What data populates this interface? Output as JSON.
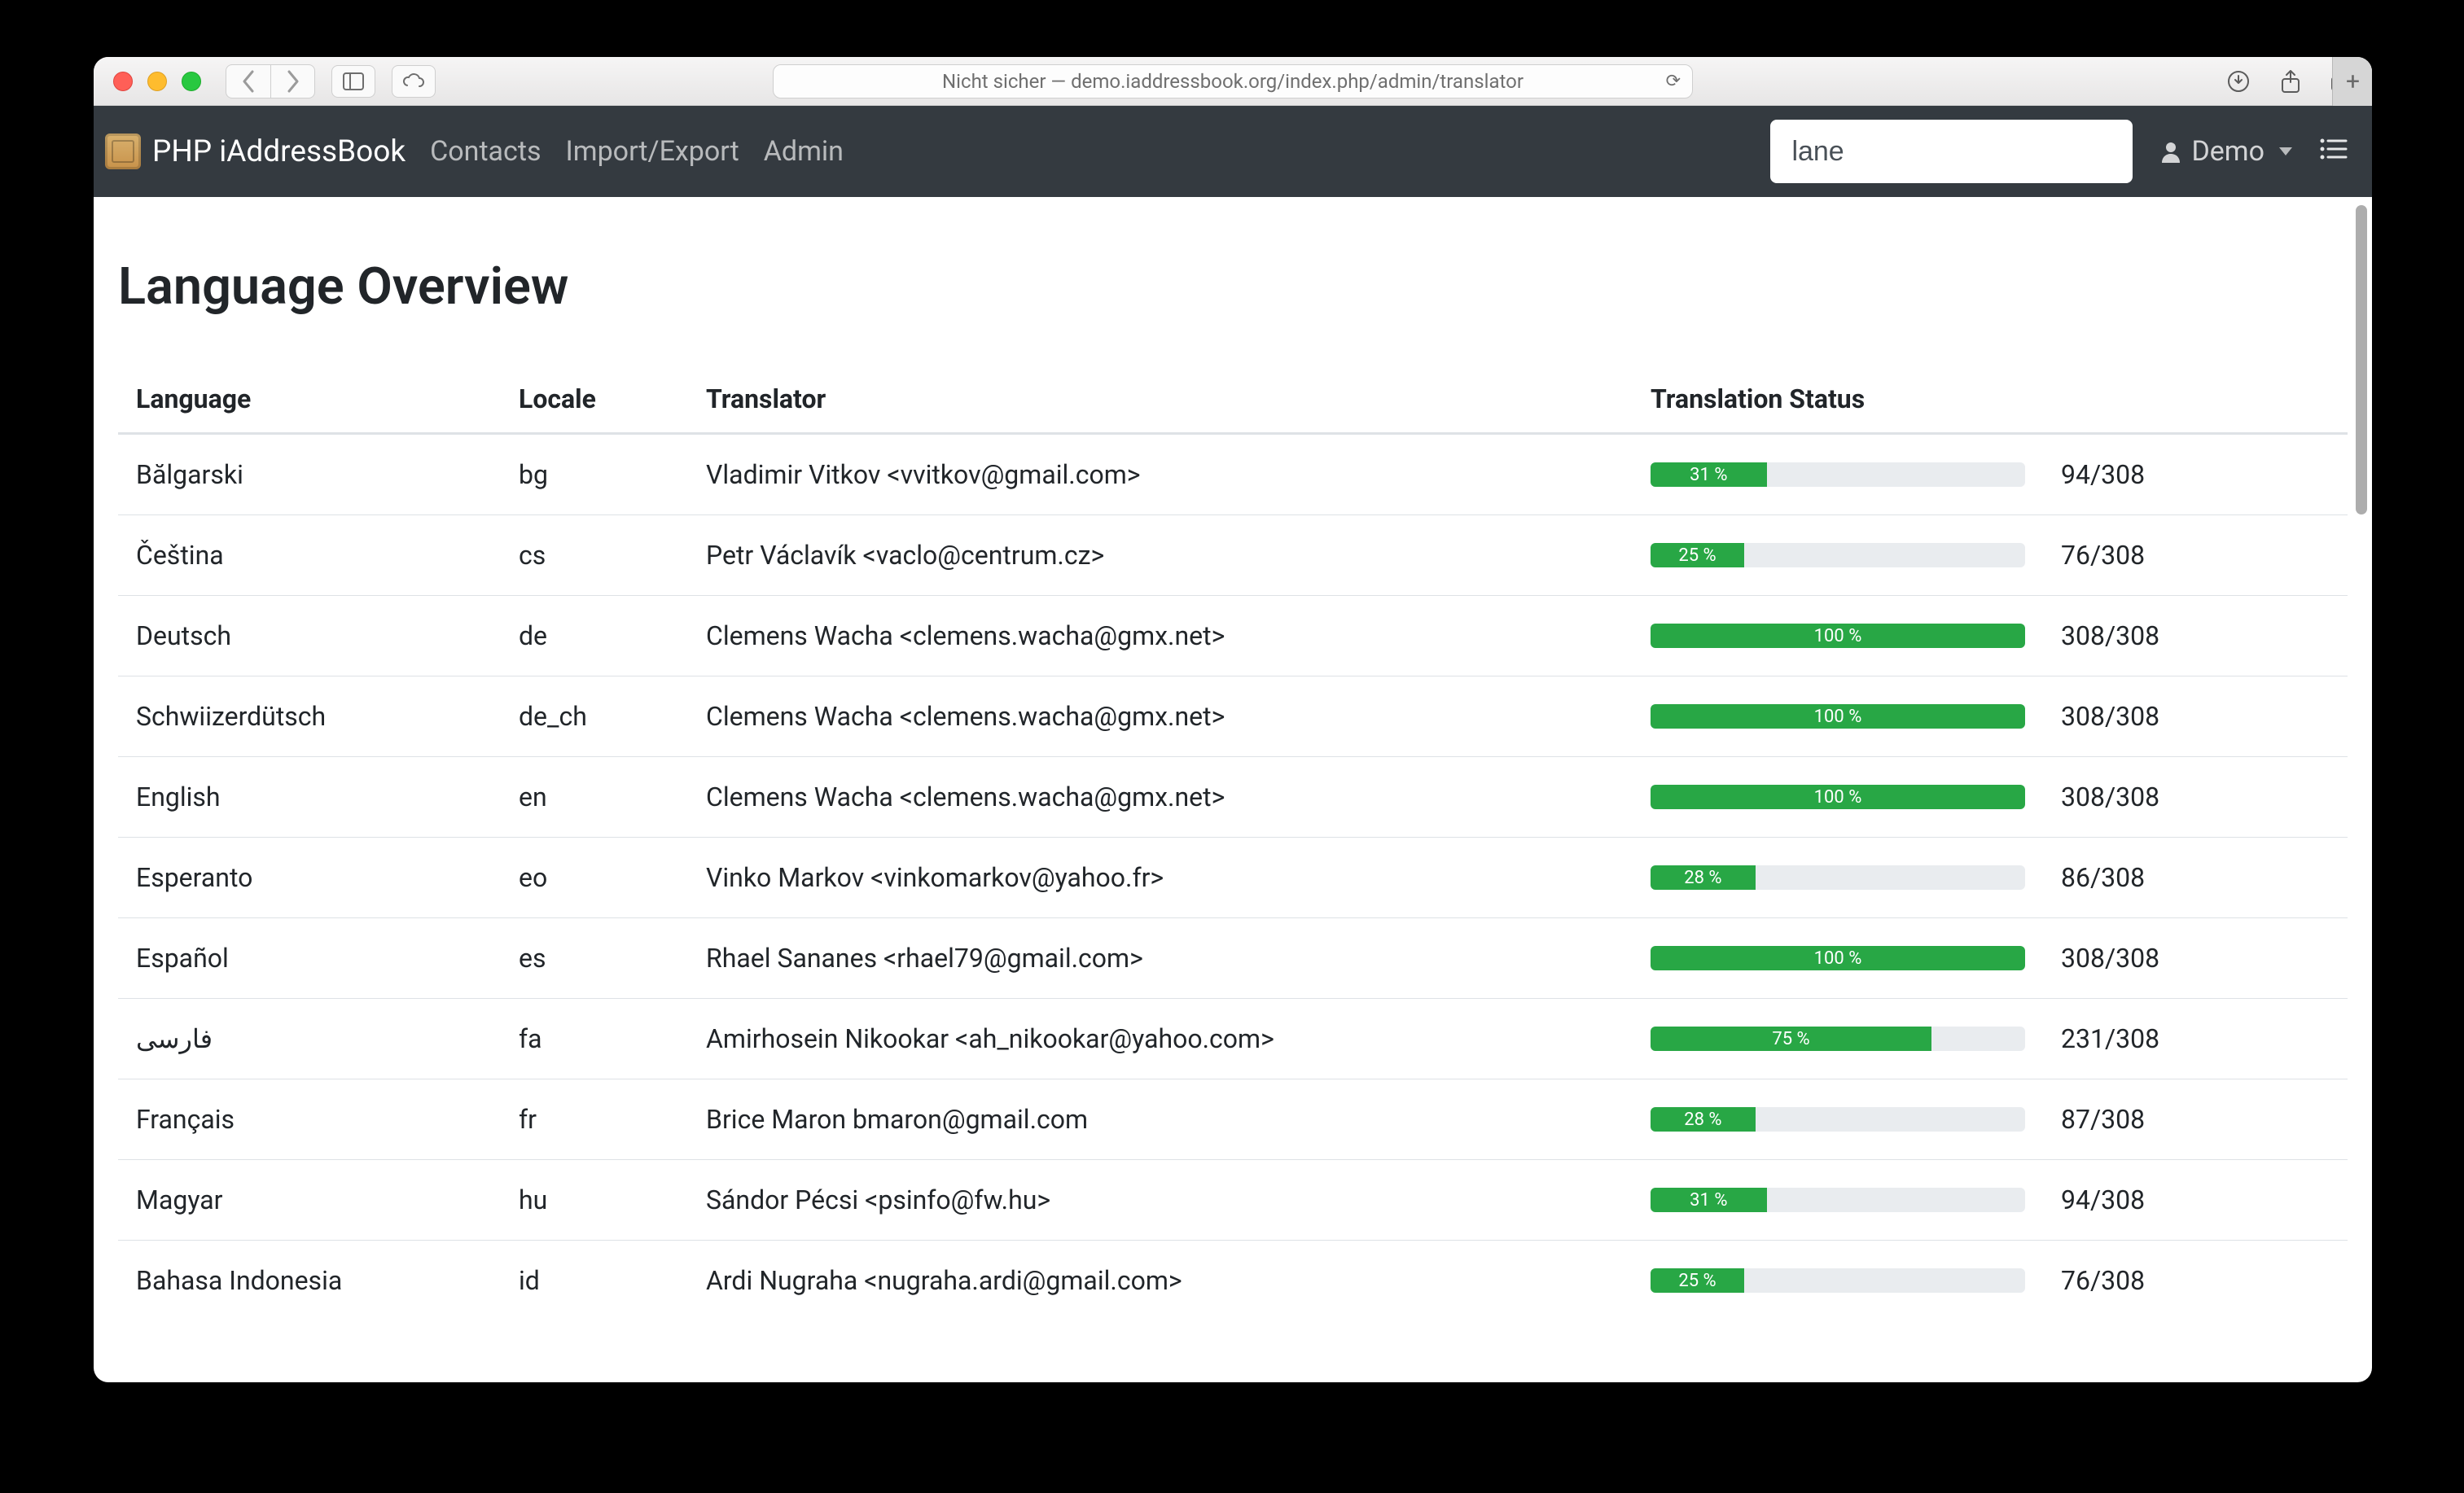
{
  "browser": {
    "address_prefix": "Nicht sicher — ",
    "url": "demo.iaddressbook.org/index.php/admin/translator"
  },
  "navbar": {
    "brand": "PHP iAddressBook",
    "links": [
      "Contacts",
      "Import/Export",
      "Admin"
    ],
    "search_value": "lane",
    "user": "Demo"
  },
  "page": {
    "heading": "Language Overview"
  },
  "table": {
    "headers": [
      "Language",
      "Locale",
      "Translator",
      "Translation Status"
    ],
    "rows": [
      {
        "lang": "Bălgarski",
        "locale": "bg",
        "translator": "Vladimir Vitkov <vvitkov@gmail.com>",
        "pct": 31,
        "done": 94,
        "total": 308
      },
      {
        "lang": "Čeština",
        "locale": "cs",
        "translator": "Petr Václavík <vaclo@centrum.cz>",
        "pct": 25,
        "done": 76,
        "total": 308
      },
      {
        "lang": "Deutsch",
        "locale": "de",
        "translator": "Clemens Wacha <clemens.wacha@gmx.net>",
        "pct": 100,
        "done": 308,
        "total": 308
      },
      {
        "lang": "Schwiizerdütsch",
        "locale": "de_ch",
        "translator": "Clemens Wacha <clemens.wacha@gmx.net>",
        "pct": 100,
        "done": 308,
        "total": 308
      },
      {
        "lang": "English",
        "locale": "en",
        "translator": "Clemens Wacha <clemens.wacha@gmx.net>",
        "pct": 100,
        "done": 308,
        "total": 308
      },
      {
        "lang": "Esperanto",
        "locale": "eo",
        "translator": "Vinko Markov <vinkomarkov@yahoo.fr>",
        "pct": 28,
        "done": 86,
        "total": 308
      },
      {
        "lang": "Español",
        "locale": "es",
        "translator": "Rhael Sananes <rhael79@gmail.com>",
        "pct": 100,
        "done": 308,
        "total": 308
      },
      {
        "lang": "فارسی",
        "locale": "fa",
        "translator": "Amirhosein Nikookar <ah_nikookar@yahoo.com>",
        "pct": 75,
        "done": 231,
        "total": 308
      },
      {
        "lang": "Français",
        "locale": "fr",
        "translator": "Brice Maron bmaron@gmail.com",
        "pct": 28,
        "done": 87,
        "total": 308
      },
      {
        "lang": "Magyar",
        "locale": "hu",
        "translator": "Sándor Pécsi <psinfo@fw.hu>",
        "pct": 31,
        "done": 94,
        "total": 308
      },
      {
        "lang": "Bahasa Indonesia",
        "locale": "id",
        "translator": "Ardi Nugraha <nugraha.ardi@gmail.com>",
        "pct": 25,
        "done": 76,
        "total": 308
      }
    ]
  }
}
